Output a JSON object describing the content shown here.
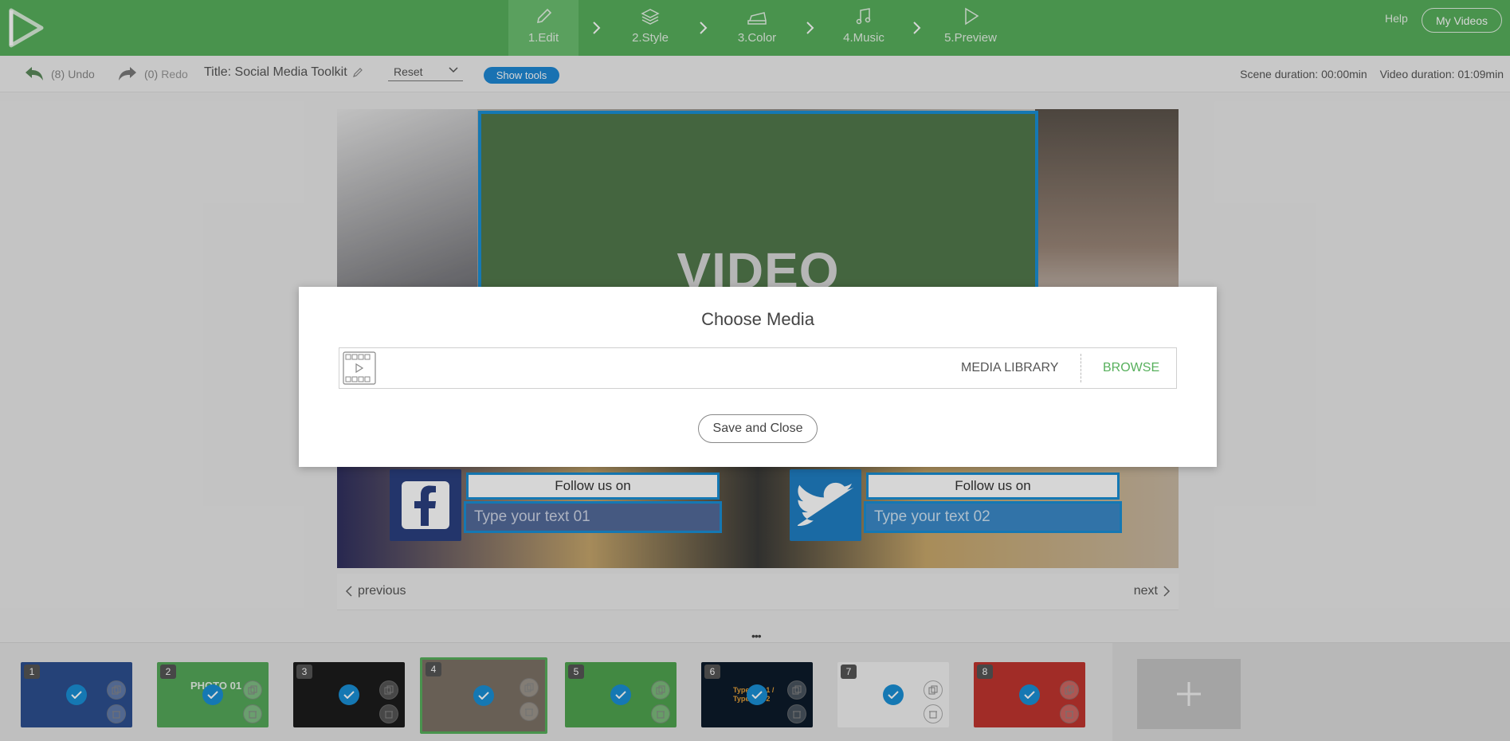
{
  "header": {
    "steps": [
      {
        "label": "1.Edit",
        "icon": "pencil-icon"
      },
      {
        "label": "2.Style",
        "icon": "layers-icon"
      },
      {
        "label": "3.Color",
        "icon": "paint-icon"
      },
      {
        "label": "4.Music",
        "icon": "music-icon"
      },
      {
        "label": "5.Preview",
        "icon": "play-icon"
      }
    ],
    "help_label": "Help",
    "my_videos_label": "My Videos",
    "brand_color": "#57b05c"
  },
  "toolbar": {
    "undo_count": "(8)",
    "undo_label": "Undo",
    "redo_count": "(0)",
    "redo_label": "Redo",
    "title": "Title: Social Media Toolkit",
    "reset_value": "Reset",
    "show_tools_label": "Show tools",
    "scene_duration": "Scene duration:  00:00min",
    "video_duration": "Video duration: 01:09min"
  },
  "canvas": {
    "video_placeholder": "VIDEO",
    "social": [
      {
        "heading": "Follow us on",
        "placeholder": "Type your text 01",
        "icon": "facebook-icon"
      },
      {
        "heading": "Follow us on",
        "placeholder": "Type your text 02",
        "icon": "twitter-icon"
      }
    ]
  },
  "nav": {
    "previous_label": "previous",
    "next_label": "next"
  },
  "thumbnails": [
    {
      "num": "1",
      "bg": "#2d4f8f"
    },
    {
      "num": "2",
      "bg": "#55a85a",
      "text": "PHOTO 01"
    },
    {
      "num": "3",
      "bg": "#1c1c1c"
    },
    {
      "num": "4",
      "bg": "#7d7266"
    },
    {
      "num": "5",
      "bg": "#4fa44f"
    },
    {
      "num": "6",
      "bg": "#0d1b2a",
      "text": "Type text 1 / Type text 2"
    },
    {
      "num": "7",
      "bg": "#f2f2f2"
    },
    {
      "num": "8",
      "bg": "#c0352f"
    }
  ],
  "modal": {
    "title": "Choose Media",
    "media_library_label": "MEDIA LIBRARY",
    "browse_label": "BROWSE",
    "save_close_label": "Save and Close"
  }
}
